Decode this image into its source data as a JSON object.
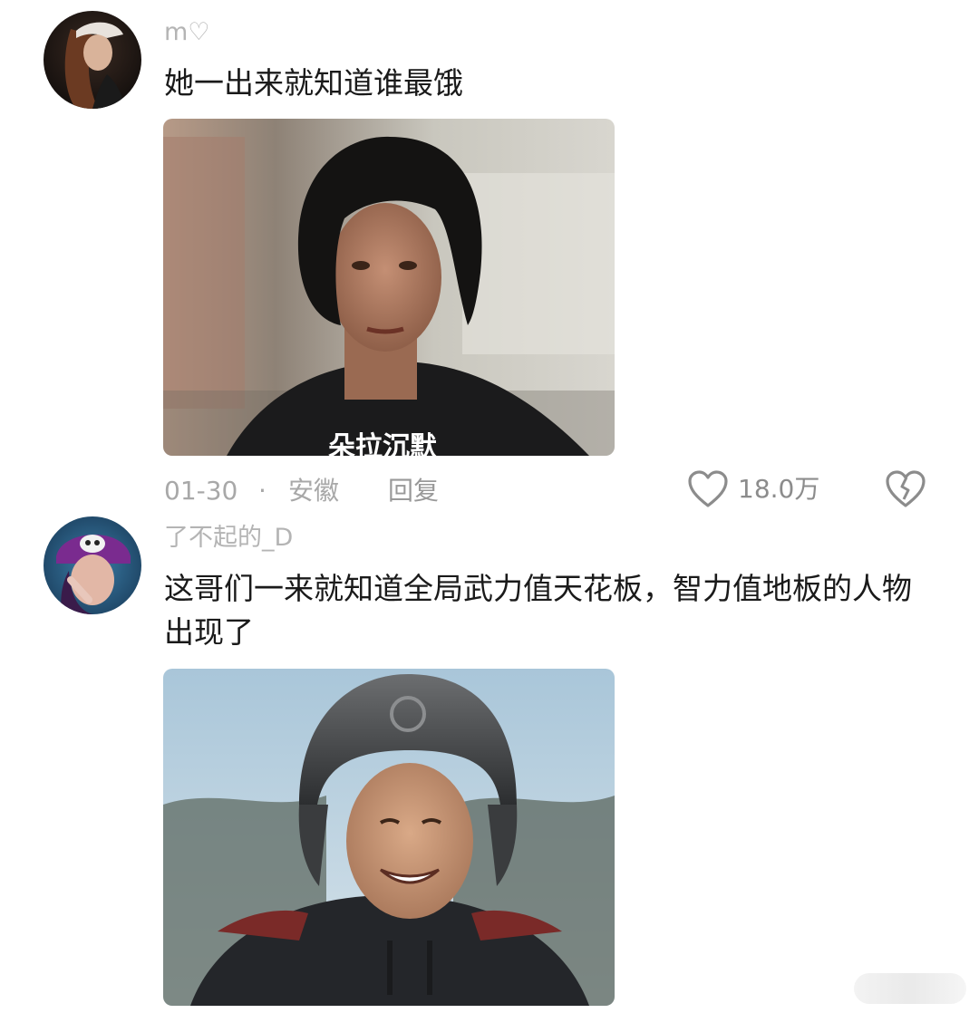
{
  "comments": [
    {
      "username": "m♡",
      "text": "她一出来就知道谁最饿",
      "image_caption": "朵拉沉默",
      "meta": {
        "date": "01-30",
        "separator": "·",
        "location": "安徽",
        "reply_label": "回复"
      },
      "likes": "18.0万"
    },
    {
      "username": "了不起的_D",
      "text": "这哥们一来就知道全局武力值天花板，智力值地板的人物出现了"
    }
  ],
  "icons": {
    "like": "heart-outline-icon",
    "dislike": "broken-heart-icon"
  },
  "colors": {
    "meta_text": "#a8a8a8",
    "username": "#b4b4b4",
    "body_text": "#1a1a1a"
  }
}
